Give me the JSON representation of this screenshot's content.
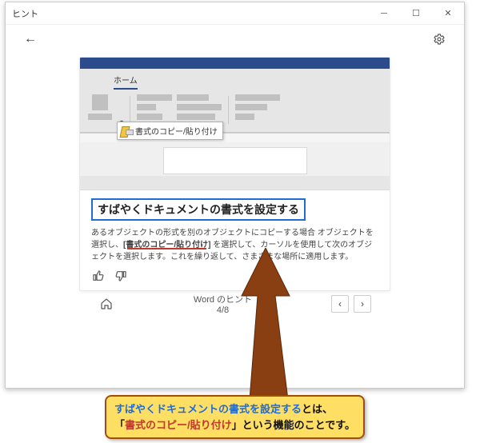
{
  "window": {
    "title": "ヒント"
  },
  "mock": {
    "tab_blank": "　",
    "tab_home": "ホーム",
    "format_painter_label": "書式のコピー/貼り付け"
  },
  "tip": {
    "title": "すばやくドキュメントの書式を設定する",
    "body_pre": "あるオブジェクトの形式を別のオブジェクトにコピーする場合 オブジェクトを選択し、",
    "body_link": "[書式のコピー/貼り付け]",
    "body_post": " を選択して、カーソルを使用して次のオブジェクトを選択します。これを繰り返して、さまざまな場所に適用します。"
  },
  "footer": {
    "category": "Word のヒント",
    "pager": "4/8"
  },
  "callout": {
    "line1a": "すばやくドキュメントの書式を設定する",
    "line1b": "とは、",
    "line2a": "「",
    "line2b": "書式のコピー/貼り付け",
    "line2c": "」という機能のことです。"
  }
}
